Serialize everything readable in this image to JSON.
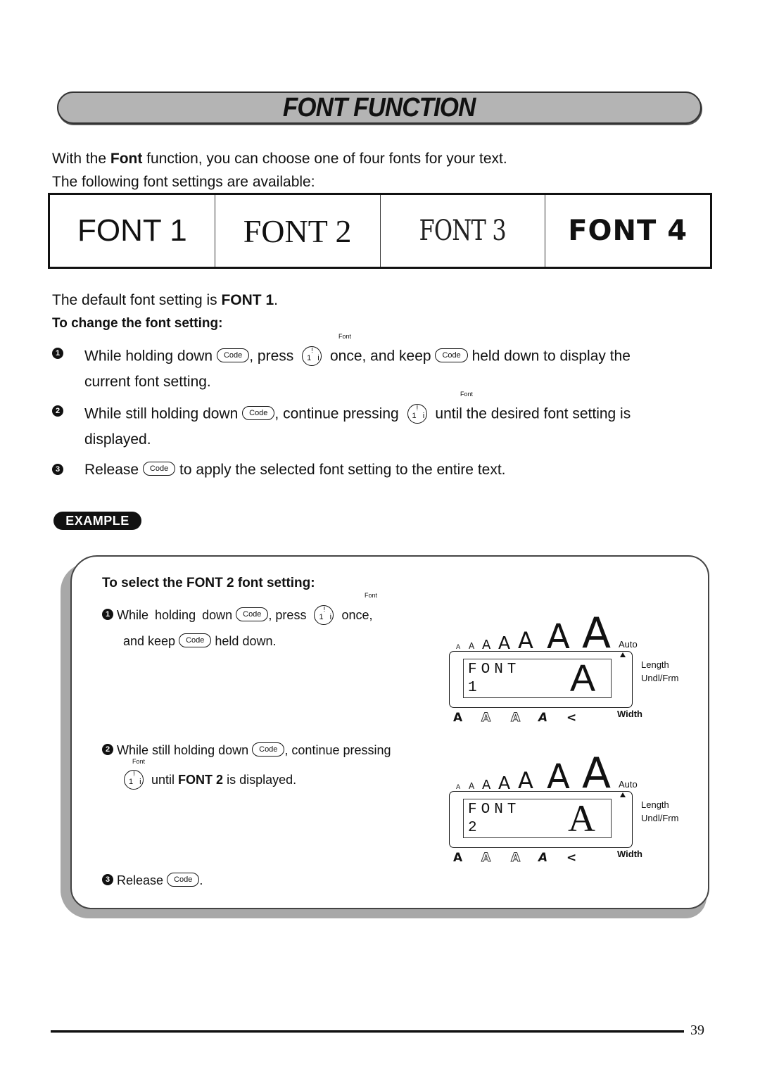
{
  "title": "FONT FUNCTION",
  "intro": {
    "line1_pre": "With the ",
    "line1_bold": "Font",
    "line1_post": " function, you can choose one of four fonts for your text.",
    "line2": "The following font settings are available:"
  },
  "font_samples": [
    "FONT 1",
    "FONT 2",
    "FONT 3",
    "FONT 4"
  ],
  "default": {
    "pre": "The default font setting is ",
    "bold": "FONT 1",
    "post": "."
  },
  "change_heading": "To change the font setting:",
  "keys": {
    "code": "Code",
    "font_caption": "Font",
    "font_glyph_top": "!",
    "font_glyph_bottom": "1 i"
  },
  "steps": [
    {
      "num": "1",
      "a": "While holding down",
      "b": ", press",
      "c": "once, and keep",
      "d": "held down to display the",
      "e": "current font setting."
    },
    {
      "num": "2",
      "a": "While still holding down",
      "b": ", continue pressing",
      "c": "until the desired font setting is",
      "d": "displayed."
    },
    {
      "num": "3",
      "a": "Release",
      "b": "to apply the selected font setting to the entire text."
    }
  ],
  "example": {
    "badge": "EXAMPLE",
    "heading": "To select the FONT 2 font setting:",
    "step1": {
      "num": "1",
      "a": "While  holding  down",
      "b": ",  press",
      "c": "once,",
      "d": "and keep",
      "e": "held down."
    },
    "step2": {
      "num": "2",
      "a": "While still holding down",
      "b": ", continue pressing",
      "c": "until ",
      "c_bold": "FONT 2",
      "d": " is displayed."
    },
    "step3": {
      "num": "3",
      "a": "Release",
      "b": "."
    },
    "lcd_common": {
      "size_glyph": "A",
      "auto": "Auto",
      "length": "Length",
      "undl": "Undl/Frm",
      "width": "Width",
      "style_glyphs": [
        "A",
        "A",
        "A",
        "A",
        "<"
      ]
    },
    "lcd1": {
      "line1": "FONT",
      "line2": "1",
      "big": "A"
    },
    "lcd2": {
      "line1": "FONT",
      "line2": "2",
      "big": "A"
    }
  },
  "page_number": "39"
}
